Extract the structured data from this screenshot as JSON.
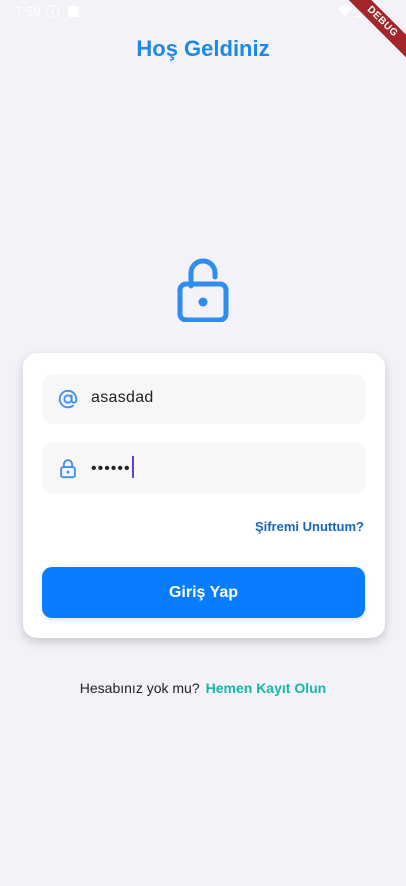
{
  "status_bar": {
    "time": "7:59",
    "info_glyph": "i"
  },
  "debug_banner": "DEBUG",
  "header": {
    "title": "Hoş Geldiniz"
  },
  "colors": {
    "primary": "#1e88e5",
    "button": "#0a7cff",
    "link_teal": "#14b8a6",
    "background": "#f3f2f8"
  },
  "form": {
    "email": {
      "icon": "at-sign-icon",
      "value": "asasdad"
    },
    "password": {
      "icon": "lock-icon",
      "value": "••••••"
    },
    "forgot_label": "Şifremi Unuttum?",
    "submit_label": "Giriş Yap"
  },
  "signup": {
    "prompt": "Hesabınız yok mu?",
    "link_label": "Hemen Kayıt Olun"
  }
}
